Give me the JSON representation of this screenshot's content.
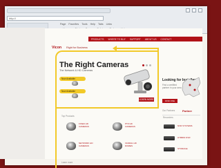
{
  "browser": {
    "address": "http://",
    "menu": [
      "Page",
      "Favorites",
      "Tools",
      "Help",
      "Tabs",
      "Links"
    ],
    "toolbar": [
      "Home",
      "Print",
      "Page",
      "Safety",
      "Tools",
      "Help"
    ]
  },
  "site": {
    "nav": [
      "PRODUCTS",
      "WHERE TO BUY",
      "SUPPORT",
      "ABOUT US",
      "CONTACT"
    ],
    "brand": "Vicon",
    "tagline": "Right for Business",
    "hero": {
      "title": "The Right Cameras",
      "subtitle": "The Network & HD Cameras",
      "badge_1": "Now Available",
      "badge_2": "Now Available",
      "learn_more": "LEARN MORE"
    },
    "right_column": {
      "title": "Looking for Installers?",
      "text": "Find a certified partner in your area",
      "button": "FIND ONE",
      "small_label": "Our Partners",
      "partner_logo": "Partner"
    },
    "grid": {
      "label": "Top Products",
      "items": [
        "FIXED HD CAMERAS",
        "PTZ HD CAMERAS",
        "NETWORK HD CAMERAS",
        "VANDAL HD DOMES",
        "DOME HD CAMERAS",
        "INDOOR DOMES"
      ],
      "right_label": "Recorders",
      "right_items": [
        "NVR SYSTEMS",
        "HYBRID DVR",
        "STORAGE"
      ]
    },
    "footer_label": "Learn more"
  },
  "colors": {
    "brand_red": "#b11218",
    "accent_yellow": "#f2c928",
    "background": "#7a1414"
  }
}
